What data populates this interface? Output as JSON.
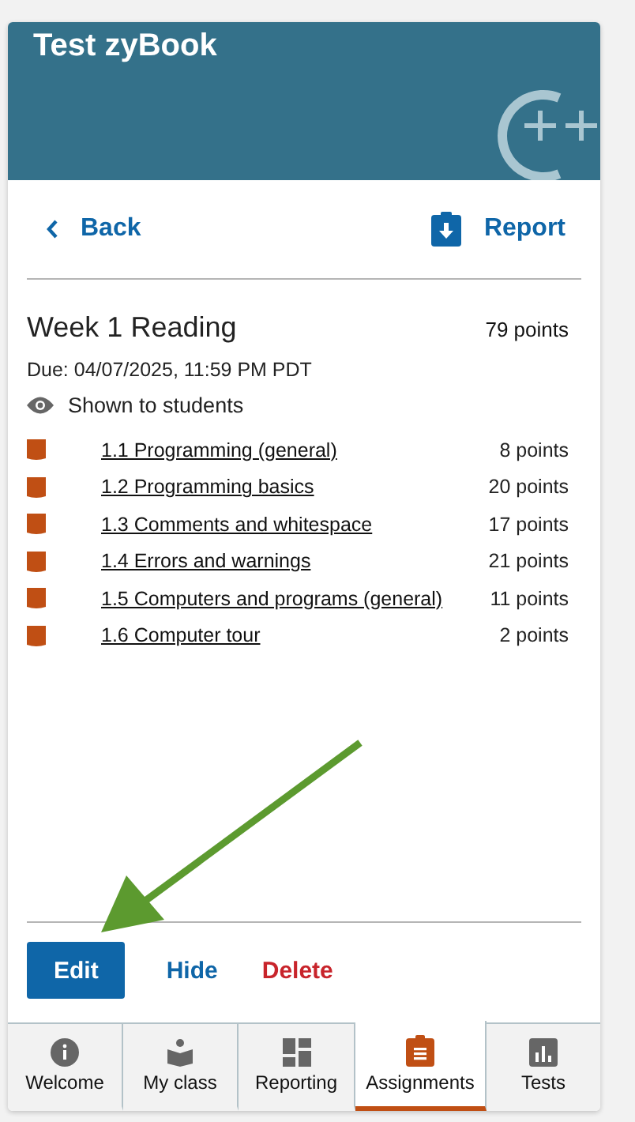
{
  "header": {
    "title": "Test zyBook"
  },
  "nav": {
    "back": "Back",
    "report": "Report"
  },
  "assignment": {
    "title": "Week 1 Reading",
    "points": "79 points",
    "due": "Due: 04/07/2025, 11:59 PM PDT",
    "visibility": "Shown to students"
  },
  "sections": [
    {
      "label": "1.1 Programming (general)",
      "points": "8 points"
    },
    {
      "label": "1.2 Programming basics",
      "points": "20 points"
    },
    {
      "label": "1.3 Comments and whitespace",
      "points": "17 points"
    },
    {
      "label": "1.4 Errors and warnings",
      "points": "21 points"
    },
    {
      "label": "1.5 Computers and programs (general)",
      "points": "11 points"
    },
    {
      "label": "1.6 Computer tour",
      "points": "2 points"
    }
  ],
  "actions": [
    {
      "label": "Edit",
      "kind": "primary"
    },
    {
      "label": "Hide",
      "kind": "link"
    },
    {
      "label": "Delete",
      "kind": "danger"
    }
  ],
  "tabs": [
    {
      "label": "Welcome",
      "kind": "info",
      "selected": false
    },
    {
      "label": "My class",
      "kind": "reader",
      "selected": false
    },
    {
      "label": "Reporting",
      "kind": "dashboard",
      "selected": false
    },
    {
      "label": "Assignments",
      "kind": "clipboard",
      "selected": true
    },
    {
      "label": "Tests",
      "kind": "chart",
      "selected": false
    }
  ]
}
